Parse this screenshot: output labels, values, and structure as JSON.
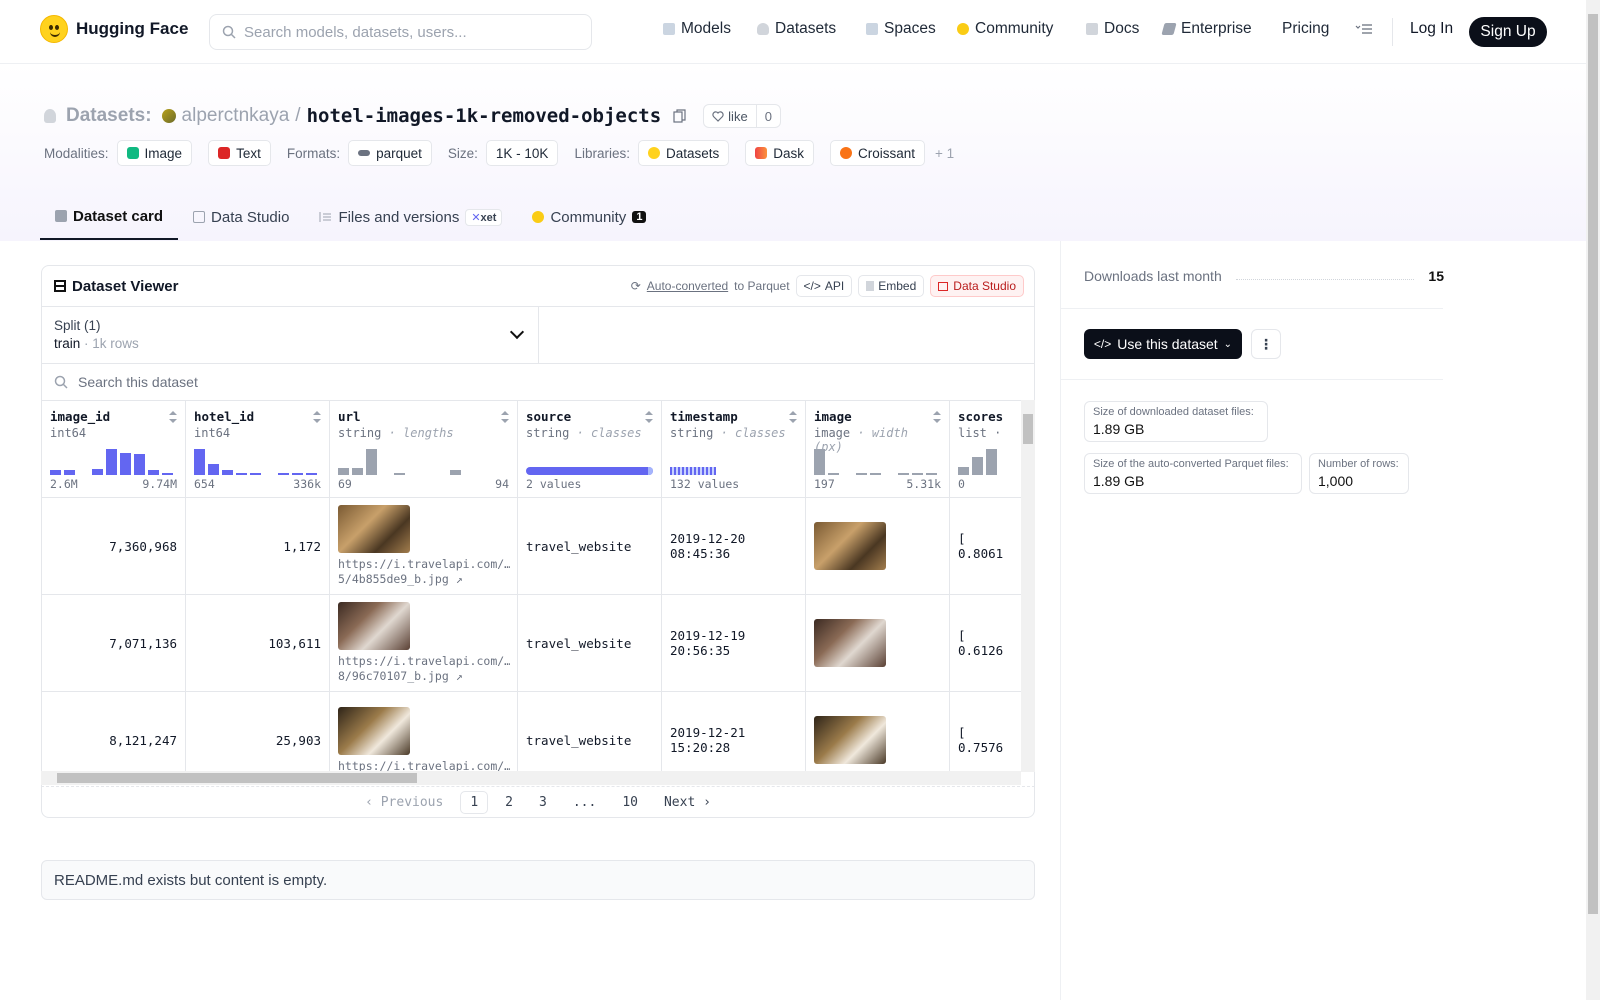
{
  "nav": {
    "brand": "Hugging Face",
    "search_placeholder": "Search models, datasets, users...",
    "items": [
      "Models",
      "Datasets",
      "Spaces",
      "Community",
      "Docs",
      "Enterprise",
      "Pricing"
    ],
    "login": "Log In",
    "signup": "Sign Up"
  },
  "repo": {
    "section": "Datasets:",
    "owner": "alperctnkaya",
    "name": "hotel-images-1k-removed-objects",
    "like_label": "like",
    "like_count": "0",
    "modalities_label": "Modalities:",
    "modalities": [
      "Image",
      "Text"
    ],
    "formats_label": "Formats:",
    "format": "parquet",
    "size_label": "Size:",
    "size": "1K - 10K",
    "libraries_label": "Libraries:",
    "libraries": [
      "Datasets",
      "Dask",
      "Croissant"
    ],
    "more_libraries": "+ 1"
  },
  "tabs": {
    "card": "Dataset card",
    "studio": "Data Studio",
    "files": "Files and versions",
    "xet": "xet",
    "community": "Community",
    "community_count": "1"
  },
  "viewer": {
    "title": "Dataset Viewer",
    "auto_converted": "Auto-converted",
    "to_parquet": "to Parquet",
    "api": "API",
    "embed": "Embed",
    "data_studio": "Data Studio",
    "split_label": "Split (1)",
    "split_value": "train",
    "split_rows": "1k rows",
    "search_placeholder": "Search this dataset",
    "columns": [
      {
        "name": "image_id",
        "type": "int64",
        "hint": "",
        "min": "2.6M",
        "max": "9.74M"
      },
      {
        "name": "hotel_id",
        "type": "int64",
        "hint": "",
        "min": "654",
        "max": "336k"
      },
      {
        "name": "url",
        "type": "string",
        "hint": "lengths",
        "min": "69",
        "max": "94"
      },
      {
        "name": "source",
        "type": "string",
        "hint": "classes",
        "min": "2 values",
        "max": ""
      },
      {
        "name": "timestamp",
        "type": "string",
        "hint": "classes",
        "min": "132 values",
        "max": ""
      },
      {
        "name": "image",
        "type": "image",
        "hint": "width (px)",
        "min": "197",
        "max": "5.31k"
      },
      {
        "name": "scores",
        "type": "list",
        "hint": "",
        "min": "0",
        "max": ""
      }
    ],
    "rows": [
      {
        "image_id": "7,360,968",
        "hotel_id": "1,172",
        "url": "https://i.travelapi.com/…",
        "url2": "5/4b855de9_b.jpg ↗",
        "source": "travel_website",
        "ts1": "2019-12-20",
        "ts2": "08:45:36",
        "scores1": "[",
        "scores2": "0.8061"
      },
      {
        "image_id": "7,071,136",
        "hotel_id": "103,611",
        "url": "https://i.travelapi.com/…",
        "url2": "8/96c70107_b.jpg ↗",
        "source": "travel_website",
        "ts1": "2019-12-19",
        "ts2": "20:56:35",
        "scores1": "[",
        "scores2": "0.6126"
      },
      {
        "image_id": "8,121,247",
        "hotel_id": "25,903",
        "url": "https://i.travelapi.com/…",
        "url2": "",
        "source": "travel_website",
        "ts1": "2019-12-21",
        "ts2": "15:20:28",
        "scores1": "[",
        "scores2": "0.7576"
      }
    ],
    "pager": {
      "prev": "Previous",
      "pages": [
        "1",
        "2",
        "3",
        "...",
        "10"
      ],
      "next": "Next"
    }
  },
  "readme": "README.md exists but content is empty.",
  "side": {
    "downloads_label": "Downloads last month",
    "downloads": "15",
    "use_button": "Use this dataset",
    "size_files_label": "Size of downloaded dataset files:",
    "size_files": "1.89 GB",
    "size_parquet_label": "Size of the auto-converted Parquet files:",
    "size_parquet": "1.89 GB",
    "rows_label": "Number of rows:",
    "rows": "1,000"
  },
  "colors": {
    "accent": "#6366f1",
    "brand": "#ffd21e",
    "dark": "#0b0f19"
  }
}
